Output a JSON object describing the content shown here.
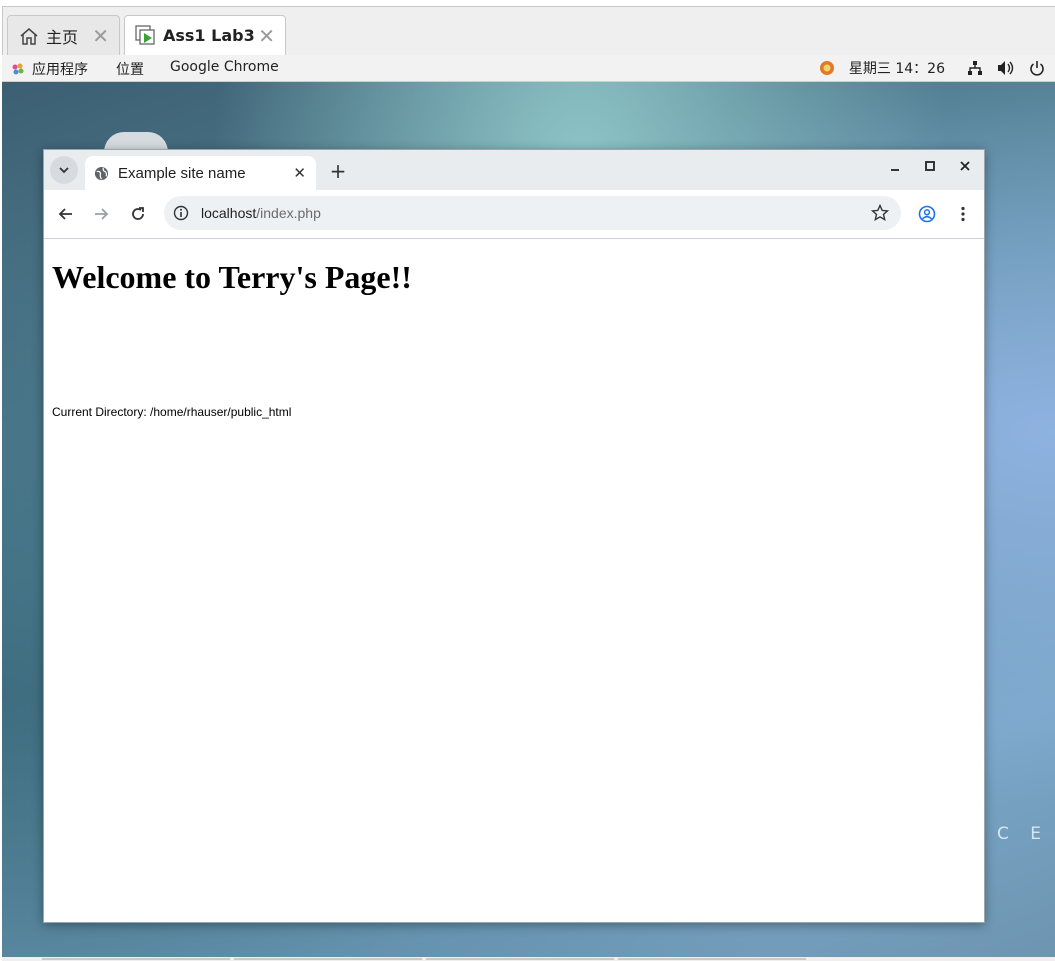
{
  "vm_tabs": [
    {
      "label": "主页",
      "icon": "home-icon"
    },
    {
      "label": "Ass1 Lab3",
      "icon": "vm-play-icon"
    }
  ],
  "topbar": {
    "applications": "应用程序",
    "places": "位置",
    "active_app": "Google Chrome",
    "clock": "星期三 14：26"
  },
  "desktop": {
    "watermark": "C E"
  },
  "browser": {
    "tab_title": "Example site name",
    "url_host": "localhost",
    "url_path": "/index.php"
  },
  "page": {
    "heading": "Welcome to Terry's Page!!",
    "directory": "Current Directory: /home/rhauser/public_html"
  },
  "colors": {
    "vm_play": "#3aa335",
    "profile": "#1a73e8"
  }
}
